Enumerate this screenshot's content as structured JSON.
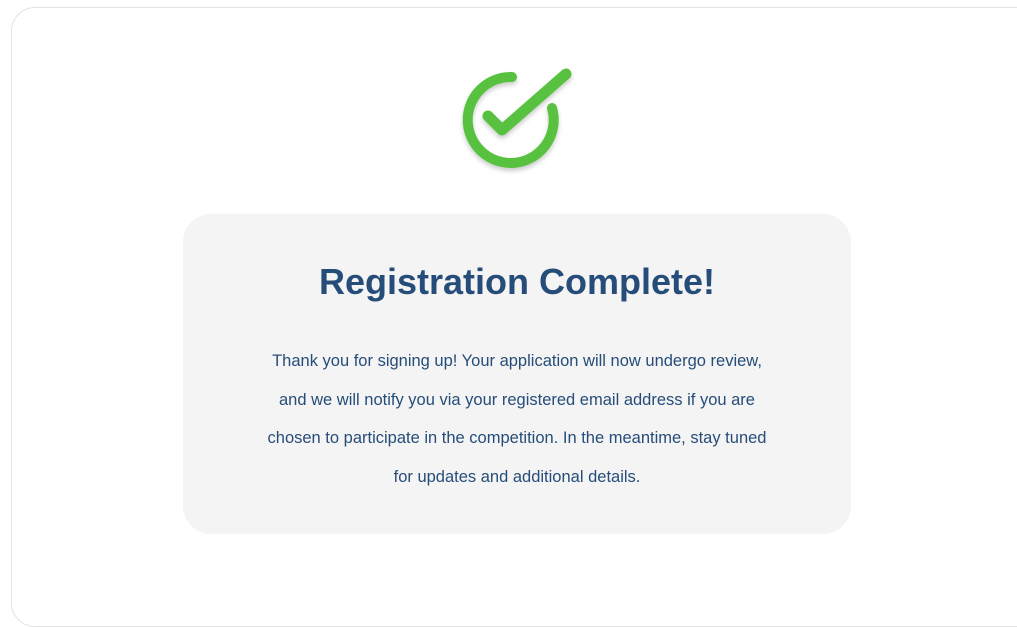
{
  "icons": {
    "success": "check-circle-icon"
  },
  "colors": {
    "accent_green": "#58c23f",
    "title_navy": "#264d79",
    "panel_bg": "#f4f4f4"
  },
  "confirmation": {
    "title": "Registration Complete!",
    "message": "Thank you for signing up! Your application will now undergo review, and we will notify you via your registered email address if you are chosen to participate in the competition. In the meantime, stay tuned for updates and additional details."
  }
}
